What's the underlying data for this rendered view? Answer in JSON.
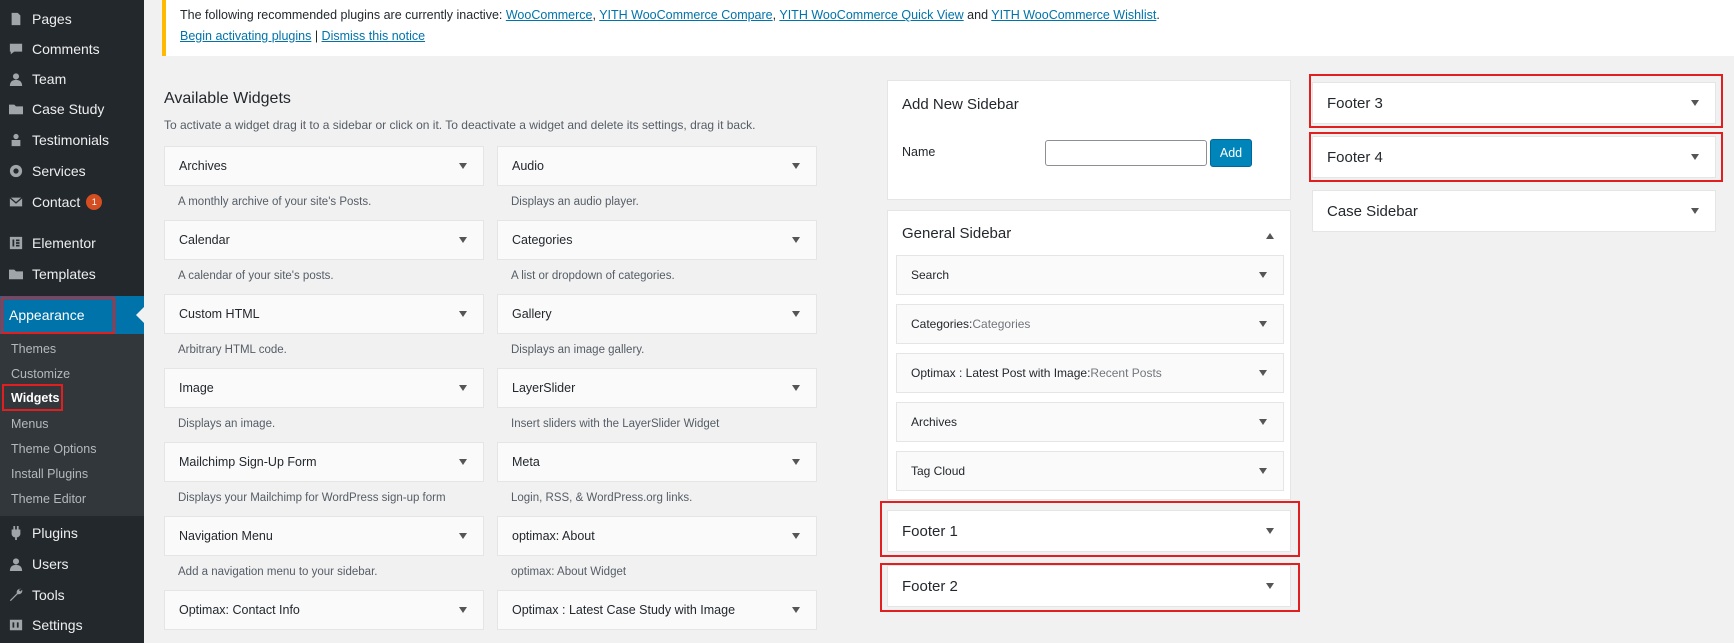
{
  "admin_menu": {
    "items": [
      {
        "label": "Pages",
        "icon": "pages-icon"
      },
      {
        "label": "Comments",
        "icon": "comments-icon"
      },
      {
        "label": "Team",
        "icon": "team-icon"
      },
      {
        "label": "Case Study",
        "icon": "folder-icon"
      },
      {
        "label": "Testimonials",
        "icon": "testimonials-icon"
      },
      {
        "label": "Services",
        "icon": "services-icon"
      },
      {
        "label": "Contact",
        "icon": "mail-icon",
        "badge": "1"
      },
      {
        "label": "Elementor",
        "icon": "elementor-icon"
      },
      {
        "label": "Templates",
        "icon": "folder-icon"
      }
    ],
    "appearance": {
      "label": "Appearance",
      "icon": "paintbrush-icon"
    },
    "submenu": [
      "Themes",
      "Customize",
      "Widgets",
      "Menus",
      "Theme Options",
      "Install Plugins",
      "Theme Editor"
    ],
    "bottom_items": [
      {
        "label": "Plugins",
        "icon": "plugins-icon"
      },
      {
        "label": "Users",
        "icon": "users-icon"
      },
      {
        "label": "Tools",
        "icon": "tools-icon"
      },
      {
        "label": "Settings",
        "icon": "settings-icon"
      }
    ]
  },
  "notice": {
    "prefix": "The following recommended plugins are currently inactive: ",
    "links": [
      "WooCommerce",
      "YITH WooCommerce Compare",
      "YITH WooCommerce Quick View",
      "YITH WooCommerce Wishlist"
    ],
    "sep": ", ",
    "and": " and ",
    "suffix": ".",
    "begin_link": "Begin activating plugins",
    "divider": " | ",
    "dismiss_link": "Dismiss this notice"
  },
  "available_widgets": {
    "title": "Available Widgets",
    "description": "To activate a widget drag it to a sidebar or click on it. To deactivate a widget and delete its settings, drag it back.",
    "left": [
      {
        "name": "Archives",
        "desc": "A monthly archive of your site's Posts."
      },
      {
        "name": "Calendar",
        "desc": "A calendar of your site's posts."
      },
      {
        "name": "Custom HTML",
        "desc": "Arbitrary HTML code."
      },
      {
        "name": "Image",
        "desc": "Displays an image."
      },
      {
        "name": "Mailchimp Sign-Up Form",
        "desc": "Displays your Mailchimp for WordPress sign-up form"
      },
      {
        "name": "Navigation Menu",
        "desc": "Add a navigation menu to your sidebar."
      },
      {
        "name": "Optimax: Contact Info",
        "desc": ""
      }
    ],
    "right": [
      {
        "name": "Audio",
        "desc": "Displays an audio player."
      },
      {
        "name": "Categories",
        "desc": "A list or dropdown of categories."
      },
      {
        "name": "Gallery",
        "desc": "Displays an image gallery."
      },
      {
        "name": "LayerSlider",
        "desc": "Insert sliders with the LayerSlider Widget"
      },
      {
        "name": "Meta",
        "desc": "Login, RSS, & WordPress.org links."
      },
      {
        "name": "optimax: About",
        "desc": "optimax: About Widget"
      },
      {
        "name": "Optimax : Latest Case Study with Image",
        "desc": ""
      }
    ]
  },
  "add_sidebar": {
    "title": "Add New Sidebar",
    "name_label": "Name",
    "name_value": "",
    "button": "Add"
  },
  "general_sidebar": {
    "title": "General Sidebar",
    "widgets": [
      {
        "name": "Search",
        "sub": ""
      },
      {
        "name": "Categories: ",
        "sub": "Categories"
      },
      {
        "name": "Optimax : Latest Post with Image: ",
        "sub": "Recent Posts"
      },
      {
        "name": "Archives",
        "sub": ""
      },
      {
        "name": "Tag Cloud",
        "sub": ""
      }
    ]
  },
  "sidebars": {
    "footer1": "Footer 1",
    "footer2": "Footer 2",
    "footer3": "Footer 3",
    "footer4": "Footer 4",
    "case": "Case Sidebar"
  },
  "colors": {
    "accent": "#0073aa",
    "highlight": "#e02020",
    "notice_border": "#ffb900",
    "badge": "#d54e21"
  }
}
